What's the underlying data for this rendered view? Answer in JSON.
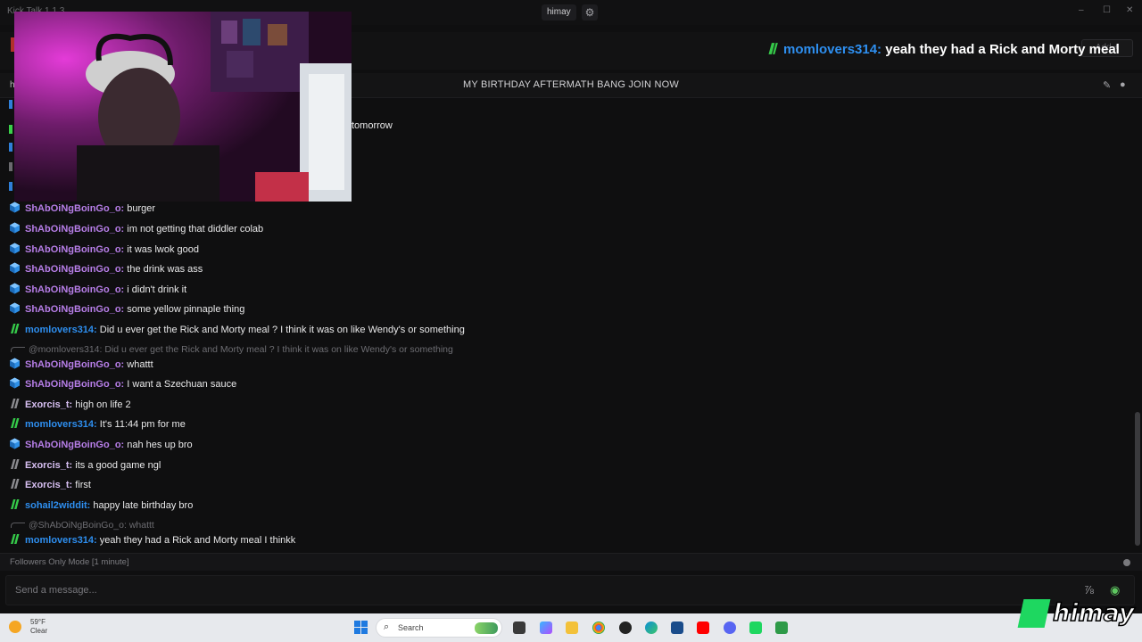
{
  "window": {
    "app_title": "Kick Talk 1.1.3",
    "channel": "himay",
    "settings_icon": "gear-icon",
    "minimize": "–",
    "maximize": "☐",
    "close": "✕"
  },
  "banner": {
    "username": "momlovers314:",
    "text": "yeah they had a Rick and Morty meal",
    "username_color": "#2e8ff0",
    "add_label": "Add +"
  },
  "stream": {
    "h_label": "h",
    "title": "MY BIRTHDAY AFTERMATH BANG JOIN NOW",
    "icons": [
      "pin-icon",
      "user-icon"
    ]
  },
  "colors": {
    "purple_user": "#b77ee8",
    "blue_user": "#2e8ff0",
    "gray_user": "#d7bff2",
    "mention": "#6d6d72",
    "brand_green": "#1ed760"
  },
  "partial": {
    "tomorrow": "tomorrow"
  },
  "messages": [
    {
      "user": "ShAbOiNgBoinGo_o:",
      "text": "burger",
      "badge": "cube"
    },
    {
      "user": "ShAbOiNgBoinGo_o:",
      "text": "im not getting that diddler colab",
      "badge": "cube"
    },
    {
      "user": "ShAbOiNgBoinGo_o:",
      "text": "it was lwok good",
      "badge": "cube"
    },
    {
      "user": "ShAbOiNgBoinGo_o:",
      "text": "the drink was ass",
      "badge": "cube"
    },
    {
      "user": "ShAbOiNgBoinGo_o:",
      "text": "i didn't drink it",
      "badge": "cube"
    },
    {
      "user": "ShAbOiNgBoinGo_o:",
      "text": "some yellow pinnaple thing",
      "badge": "cube"
    },
    {
      "user": "momlovers314:",
      "text": "Did u ever get the Rick and Morty meal ? I think it was on like Wendy's or something",
      "badge": "green"
    },
    {
      "reply_to": "@momlovers314:",
      "reply_text": "Did u ever get the Rick and Morty meal ? I think it was on like Wendy's or something"
    },
    {
      "user": "ShAbOiNgBoinGo_o:",
      "text": "whattt",
      "badge": "cube"
    },
    {
      "user": "ShAbOiNgBoinGo_o:",
      "text": "I want a Szechuan sauce",
      "badge": "cube"
    },
    {
      "user": "Exorcis_t:",
      "text": "high on life 2",
      "badge": "gray"
    },
    {
      "user": "momlovers314:",
      "text": "It's 11:44 pm for me",
      "badge": "green"
    },
    {
      "user": "ShAbOiNgBoinGo_o:",
      "text": "nah hes up bro",
      "badge": "cube"
    },
    {
      "user": "Exorcis_t:",
      "text": "its a good game ngl",
      "badge": "gray"
    },
    {
      "user": "Exorcis_t:",
      "text": "first",
      "badge": "gray"
    },
    {
      "user": "sohail2widdit:",
      "text": "happy late birthday bro",
      "badge": "green"
    },
    {
      "reply_to": "@ShAbOiNgBoinGo_o:",
      "reply_text": "whattt"
    },
    {
      "user": "momlovers314:",
      "text": "yeah they had a Rick and Morty meal I thinkk",
      "badge": "green"
    }
  ],
  "footer": {
    "followers_mode": "Followers Only Mode [1 minute]",
    "input_placeholder": "Send a message..."
  },
  "taskbar": {
    "temp": "59°F",
    "condition": "Clear",
    "search_label": "Search"
  },
  "logo": {
    "text": "himay"
  }
}
